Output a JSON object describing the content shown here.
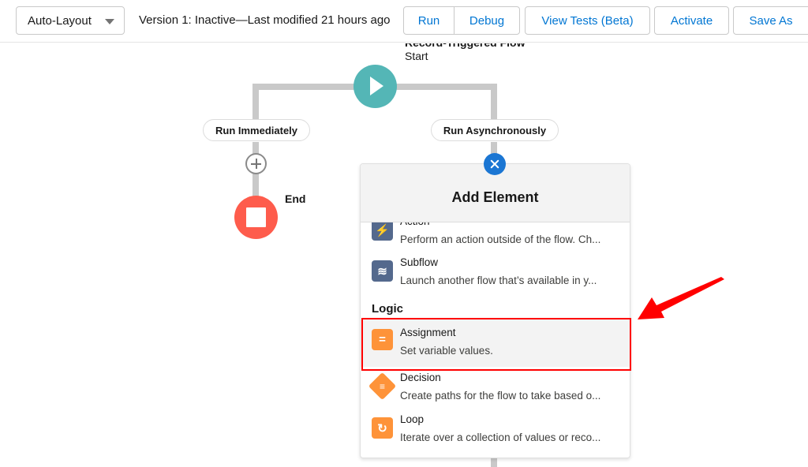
{
  "toolbar": {
    "layout_select": "Auto-Layout",
    "version_status": "Version 1: Inactive—Last modified 21 hours ago",
    "buttons": {
      "run": "Run",
      "debug": "Debug",
      "view_tests": "View Tests (Beta)",
      "activate": "Activate",
      "save_as": "Save As"
    }
  },
  "canvas": {
    "start": {
      "title": "Record-Triggered Flow",
      "label": "Start",
      "icon": "play-icon",
      "color": "#54b6b6"
    },
    "paths": [
      {
        "label": "Run Immediately"
      },
      {
        "label": "Run Asynchronously"
      }
    ],
    "end": {
      "label": "End",
      "icon": "stop-icon",
      "color": "#fe5c4c"
    }
  },
  "add_element_panel": {
    "title": "Add Element",
    "close_icon": "close-icon",
    "items_above": [
      {
        "name": "Action",
        "description": "Perform an action outside of the flow. Ch...",
        "icon": "lightning-icon",
        "color": "#54698d"
      },
      {
        "name": "Subflow",
        "description": "Launch another flow that’s available in y...",
        "icon": "subflow-icon",
        "color": "#54698d"
      }
    ],
    "logic_section": {
      "label": "Logic",
      "items": [
        {
          "name": "Assignment",
          "description": "Set variable values.",
          "icon": "assignment-icon",
          "color": "#fe9339",
          "highlighted": true
        },
        {
          "name": "Decision",
          "description": "Create paths for the flow to take based o...",
          "icon": "decision-icon",
          "color": "#fe9339"
        },
        {
          "name": "Loop",
          "description": "Iterate over a collection of values or reco...",
          "icon": "loop-icon",
          "color": "#fe9339"
        }
      ]
    }
  },
  "annotation": {
    "color": "#ff0000",
    "target": "Assignment"
  }
}
